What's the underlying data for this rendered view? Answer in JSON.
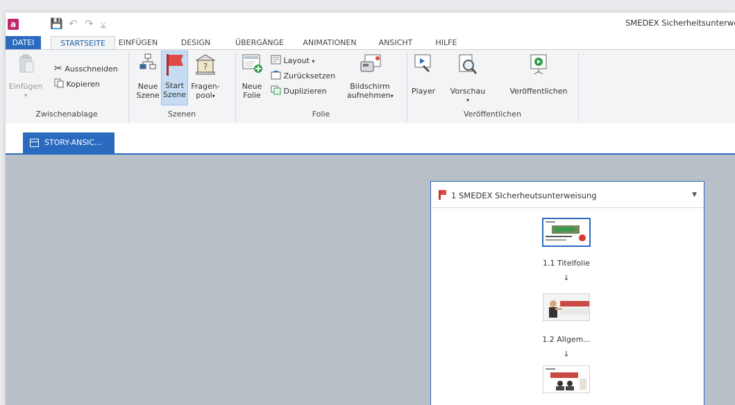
{
  "window": {
    "title": "SMEDEX Sicherheitsunterwe"
  },
  "quick_access": {
    "save": "💾",
    "undo": "↶",
    "redo": "↷",
    "more": "⩣"
  },
  "tabs": [
    "DATEI",
    "STARTSEITE",
    "EINFÜGEN",
    "DESIGN",
    "ÜBERGÄNGE",
    "ANIMATIONEN",
    "ANSICHT",
    "HILFE"
  ],
  "ribbon": {
    "clipboard": {
      "paste_label": "Einfügen",
      "cut_label": "Ausschneiden",
      "copy_label": "Kopieren",
      "group_label": "Zwischenablage"
    },
    "scenes": {
      "new_scene_1": "Neue",
      "new_scene_2": "Szene",
      "start_scene_1": "Start",
      "start_scene_2": "Szene",
      "question_pool_1": "Fragen-",
      "question_pool_2": "pool",
      "group_label": "Szenen"
    },
    "slide": {
      "new_slide_1": "Neue",
      "new_slide_2": "Folie",
      "layout_label": "Layout",
      "reset_label": "Zurücksetzen",
      "duplicate_label": "Duplizieren",
      "record_1": "Bildschirm",
      "record_2": "aufnehmen",
      "group_label": "Folie"
    },
    "publish": {
      "player_label": "Player",
      "preview_label": "Vorschau",
      "publish_label": "Veröffentlichen",
      "group_label": "Veröffentlichen"
    }
  },
  "view_tab": {
    "label": "STORY-ANSIC..."
  },
  "scene_panel": {
    "title": "1 SMEDEX SIcherheutsunterweisung",
    "slides": [
      {
        "label": "1.1 Titelfolie"
      },
      {
        "label": "1.2 Allgem..."
      },
      {
        "label": ""
      }
    ]
  },
  "colors": {
    "accent": "#2a6bbf",
    "flag": "#e04a44",
    "canvas": "#b9bfc7"
  }
}
